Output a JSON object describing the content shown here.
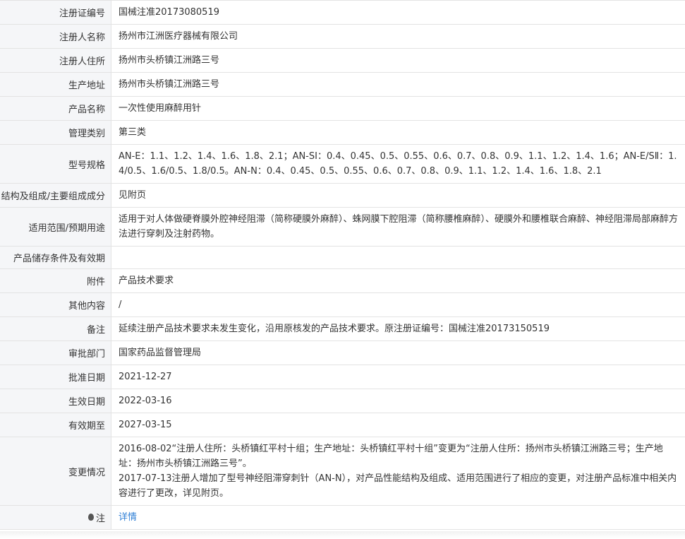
{
  "rows": [
    {
      "label": "注册证编号",
      "value": "国械注准20173080519"
    },
    {
      "label": "注册人名称",
      "value": "扬州市江洲医疗器械有限公司"
    },
    {
      "label": "注册人住所",
      "value": "扬州市头桥镇江洲路三号"
    },
    {
      "label": "生产地址",
      "value": "扬州市头桥镇江洲路三号"
    },
    {
      "label": "产品名称",
      "value": "一次性使用麻醉用针"
    },
    {
      "label": "管理类别",
      "value": "第三类"
    },
    {
      "label": "型号规格",
      "value": "AN-E：1.1、1.2、1.4、1.6、1.8、2.1；AN-SⅠ：0.4、0.45、0.5、0.55、0.6、0.7、0.8、0.9、1.1、1.2、1.4、1.6；AN-E/SⅡ：1.4/0.5、1.6/0.5、1.8/0.5。AN-N：0.4、0.45、0.5、0.55、0.6、0.7、0.8、0.9、1.1、1.2、1.4、1.6、1.8、2.1"
    },
    {
      "label": "结构及组成/主要组成成分",
      "value": "见附页"
    },
    {
      "label": "适用范围/预期用途",
      "value": "适用于对人体做硬脊膜外腔神经阻滞（简称硬膜外麻醉）、蛛网膜下腔阻滞（简称腰椎麻醉）、硬膜外和腰椎联合麻醉、神经阻滞局部麻醉方法进行穿刺及注射药物。"
    },
    {
      "label": "产品储存条件及有效期",
      "value": ""
    },
    {
      "label": "附件",
      "value": "产品技术要求"
    },
    {
      "label": "其他内容",
      "value": "/"
    },
    {
      "label": "备注",
      "value": "延续注册产品技术要求未发生变化，沿用原核发的产品技术要求。原注册证编号：国械注准20173150519"
    },
    {
      "label": "审批部门",
      "value": "国家药品监督管理局"
    },
    {
      "label": "批准日期",
      "value": "2021-12-27"
    },
    {
      "label": "生效日期",
      "value": "2022-03-16"
    },
    {
      "label": "有效期至",
      "value": "2027-03-15"
    }
  ],
  "changes": {
    "label": "变更情况",
    "line1": "2016-08-02“注册人住所：头桥镇红平村十组；生产地址：头桥镇红平村十组”变更为“注册人住所：扬州市头桥镇江洲路三号；生产地址：扬州市头桥镇江洲路三号”。",
    "line2": "2017-07-13注册人增加了型号神经阻滞穿刺针（AN-N），对产品性能结构及组成、适用范围进行了相应的变更，对注册产品标准中相关内容进行了更改，详见附页。"
  },
  "note": {
    "label": "注",
    "link": "详情",
    "icon": "pin-icon"
  }
}
